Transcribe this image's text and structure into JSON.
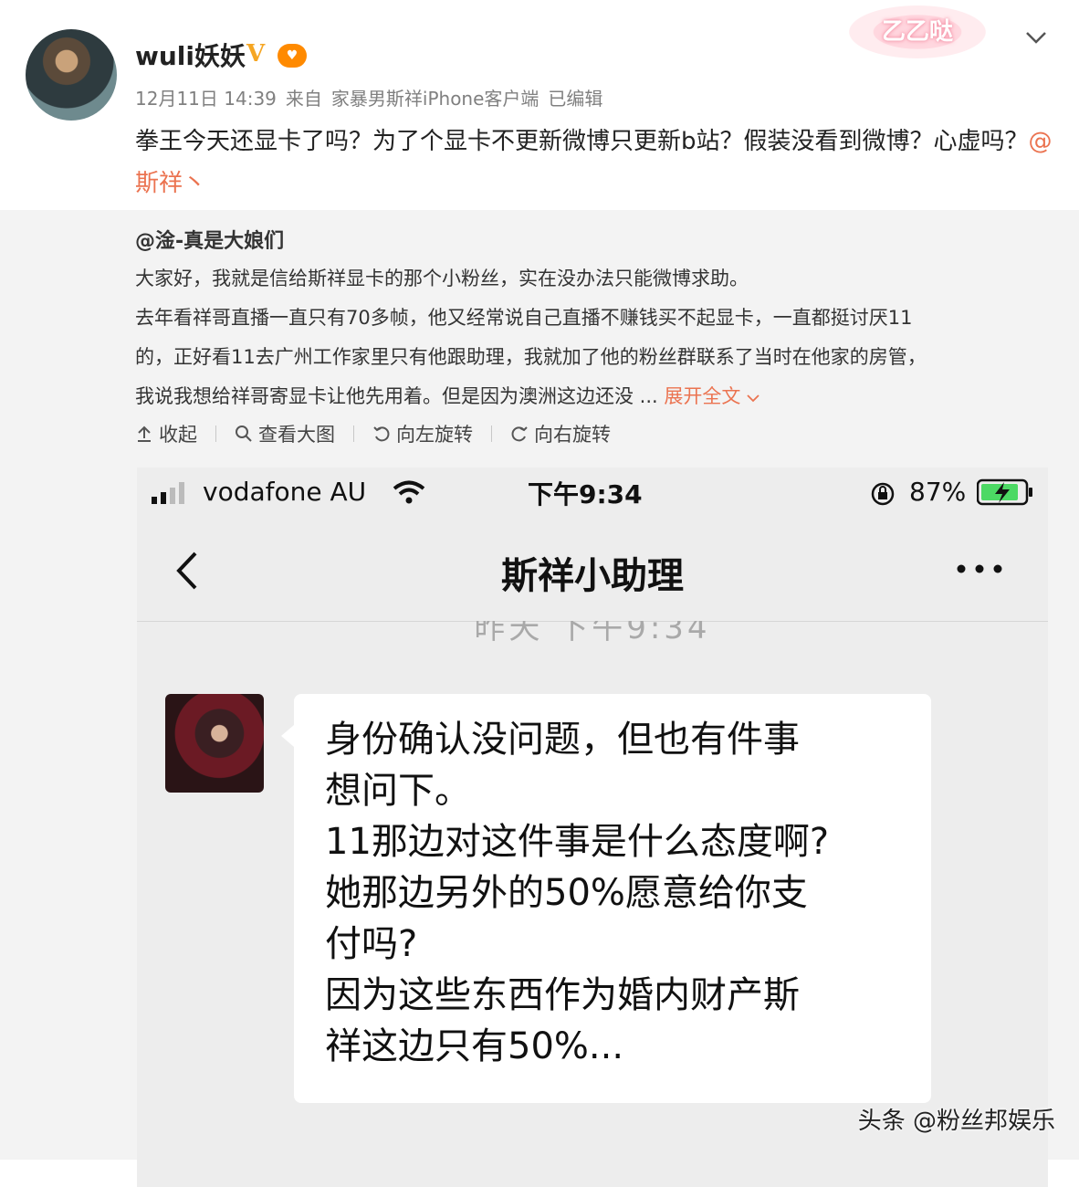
{
  "post": {
    "username": "wuli妖妖",
    "verified_badge": "V",
    "timestamp": "12月11日 14:39",
    "source_prefix": "来自",
    "source": "家暴男斯祥iPhone客户端",
    "edited": "已编辑",
    "text": "拳王今天还显卡了吗？为了个显卡不更新微博只更新b站？假装没看到微博？心虚吗？",
    "mention": "@斯祥丶",
    "sticker_text": "乙乙哒",
    "icons": {
      "expand": "chevron-down-icon"
    }
  },
  "repost": {
    "author": "@淦-真是大娘们",
    "lines": [
      "大家好，我就是信给斯祥显卡的那个小粉丝，实在没办法只能微博求助。",
      "去年看祥哥直播一直只有70多帧，他又经常说自己直播不赚钱买不起显卡，一直都挺讨厌11",
      "的，正好看11去广州工作家里只有他跟助理，我就加了他的粉丝群联系了当时在他家的房管，",
      "我说我想给祥哥寄显卡让他先用着。但是因为澳洲这边还没 ..."
    ],
    "expand_label": "展开全文",
    "actions": [
      {
        "label": "收起",
        "icon": "collapse-icon"
      },
      {
        "label": "查看大图",
        "icon": "magnifier-icon"
      },
      {
        "label": "向左旋转",
        "icon": "rotate-left-icon"
      },
      {
        "label": "向右旋转",
        "icon": "rotate-right-icon"
      }
    ]
  },
  "screenshot": {
    "carrier": "vodafone AU",
    "time": "下午9:34",
    "battery": "87%",
    "chat_title": "斯祥小助理",
    "timestamp": "昨天 下午9:34",
    "message_lines": [
      "身份确认没问题，但也有件事",
      "想问下。",
      "11那边对这件事是什么态度啊?",
      "她那边另外的50%愿意给你支",
      "付吗?",
      "因为这些东西作为婚内财产斯",
      "祥这边只有50%..."
    ]
  },
  "watermark": "头条 @粉丝邦娱乐"
}
